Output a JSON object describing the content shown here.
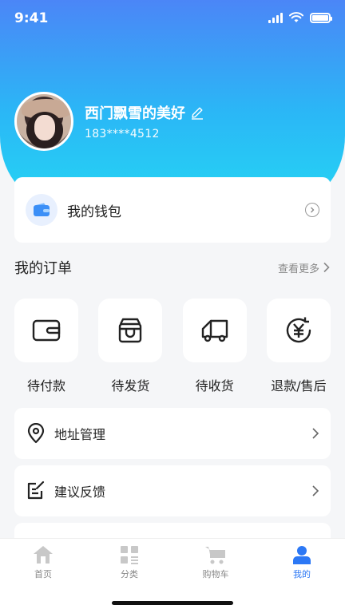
{
  "status_bar": {
    "time": "9:41"
  },
  "profile": {
    "name": "西门飘雪的美好",
    "phone": "183****4512"
  },
  "wallet": {
    "label": "我的钱包"
  },
  "orders": {
    "title": "我的订单",
    "view_more": "查看更多",
    "items": [
      {
        "label": "待付款",
        "icon": "wallet-icon"
      },
      {
        "label": "待发货",
        "icon": "box-icon"
      },
      {
        "label": "待收货",
        "icon": "truck-icon"
      },
      {
        "label": "退款/售后",
        "icon": "yen-refund-icon"
      }
    ]
  },
  "menu": [
    {
      "label": "地址管理",
      "icon": "location-pin-icon"
    },
    {
      "label": "建议反馈",
      "icon": "feedback-edit-icon"
    }
  ],
  "nav": [
    {
      "label": "首页",
      "icon": "home-icon",
      "active": false
    },
    {
      "label": "分类",
      "icon": "grid-icon",
      "active": false
    },
    {
      "label": "购物车",
      "icon": "cart-icon",
      "active": false
    },
    {
      "label": "我的",
      "icon": "user-icon",
      "active": true
    }
  ],
  "colors": {
    "accent": "#2c78f5",
    "gradient_top": "#4b86f7",
    "gradient_bottom": "#25d3f4"
  }
}
